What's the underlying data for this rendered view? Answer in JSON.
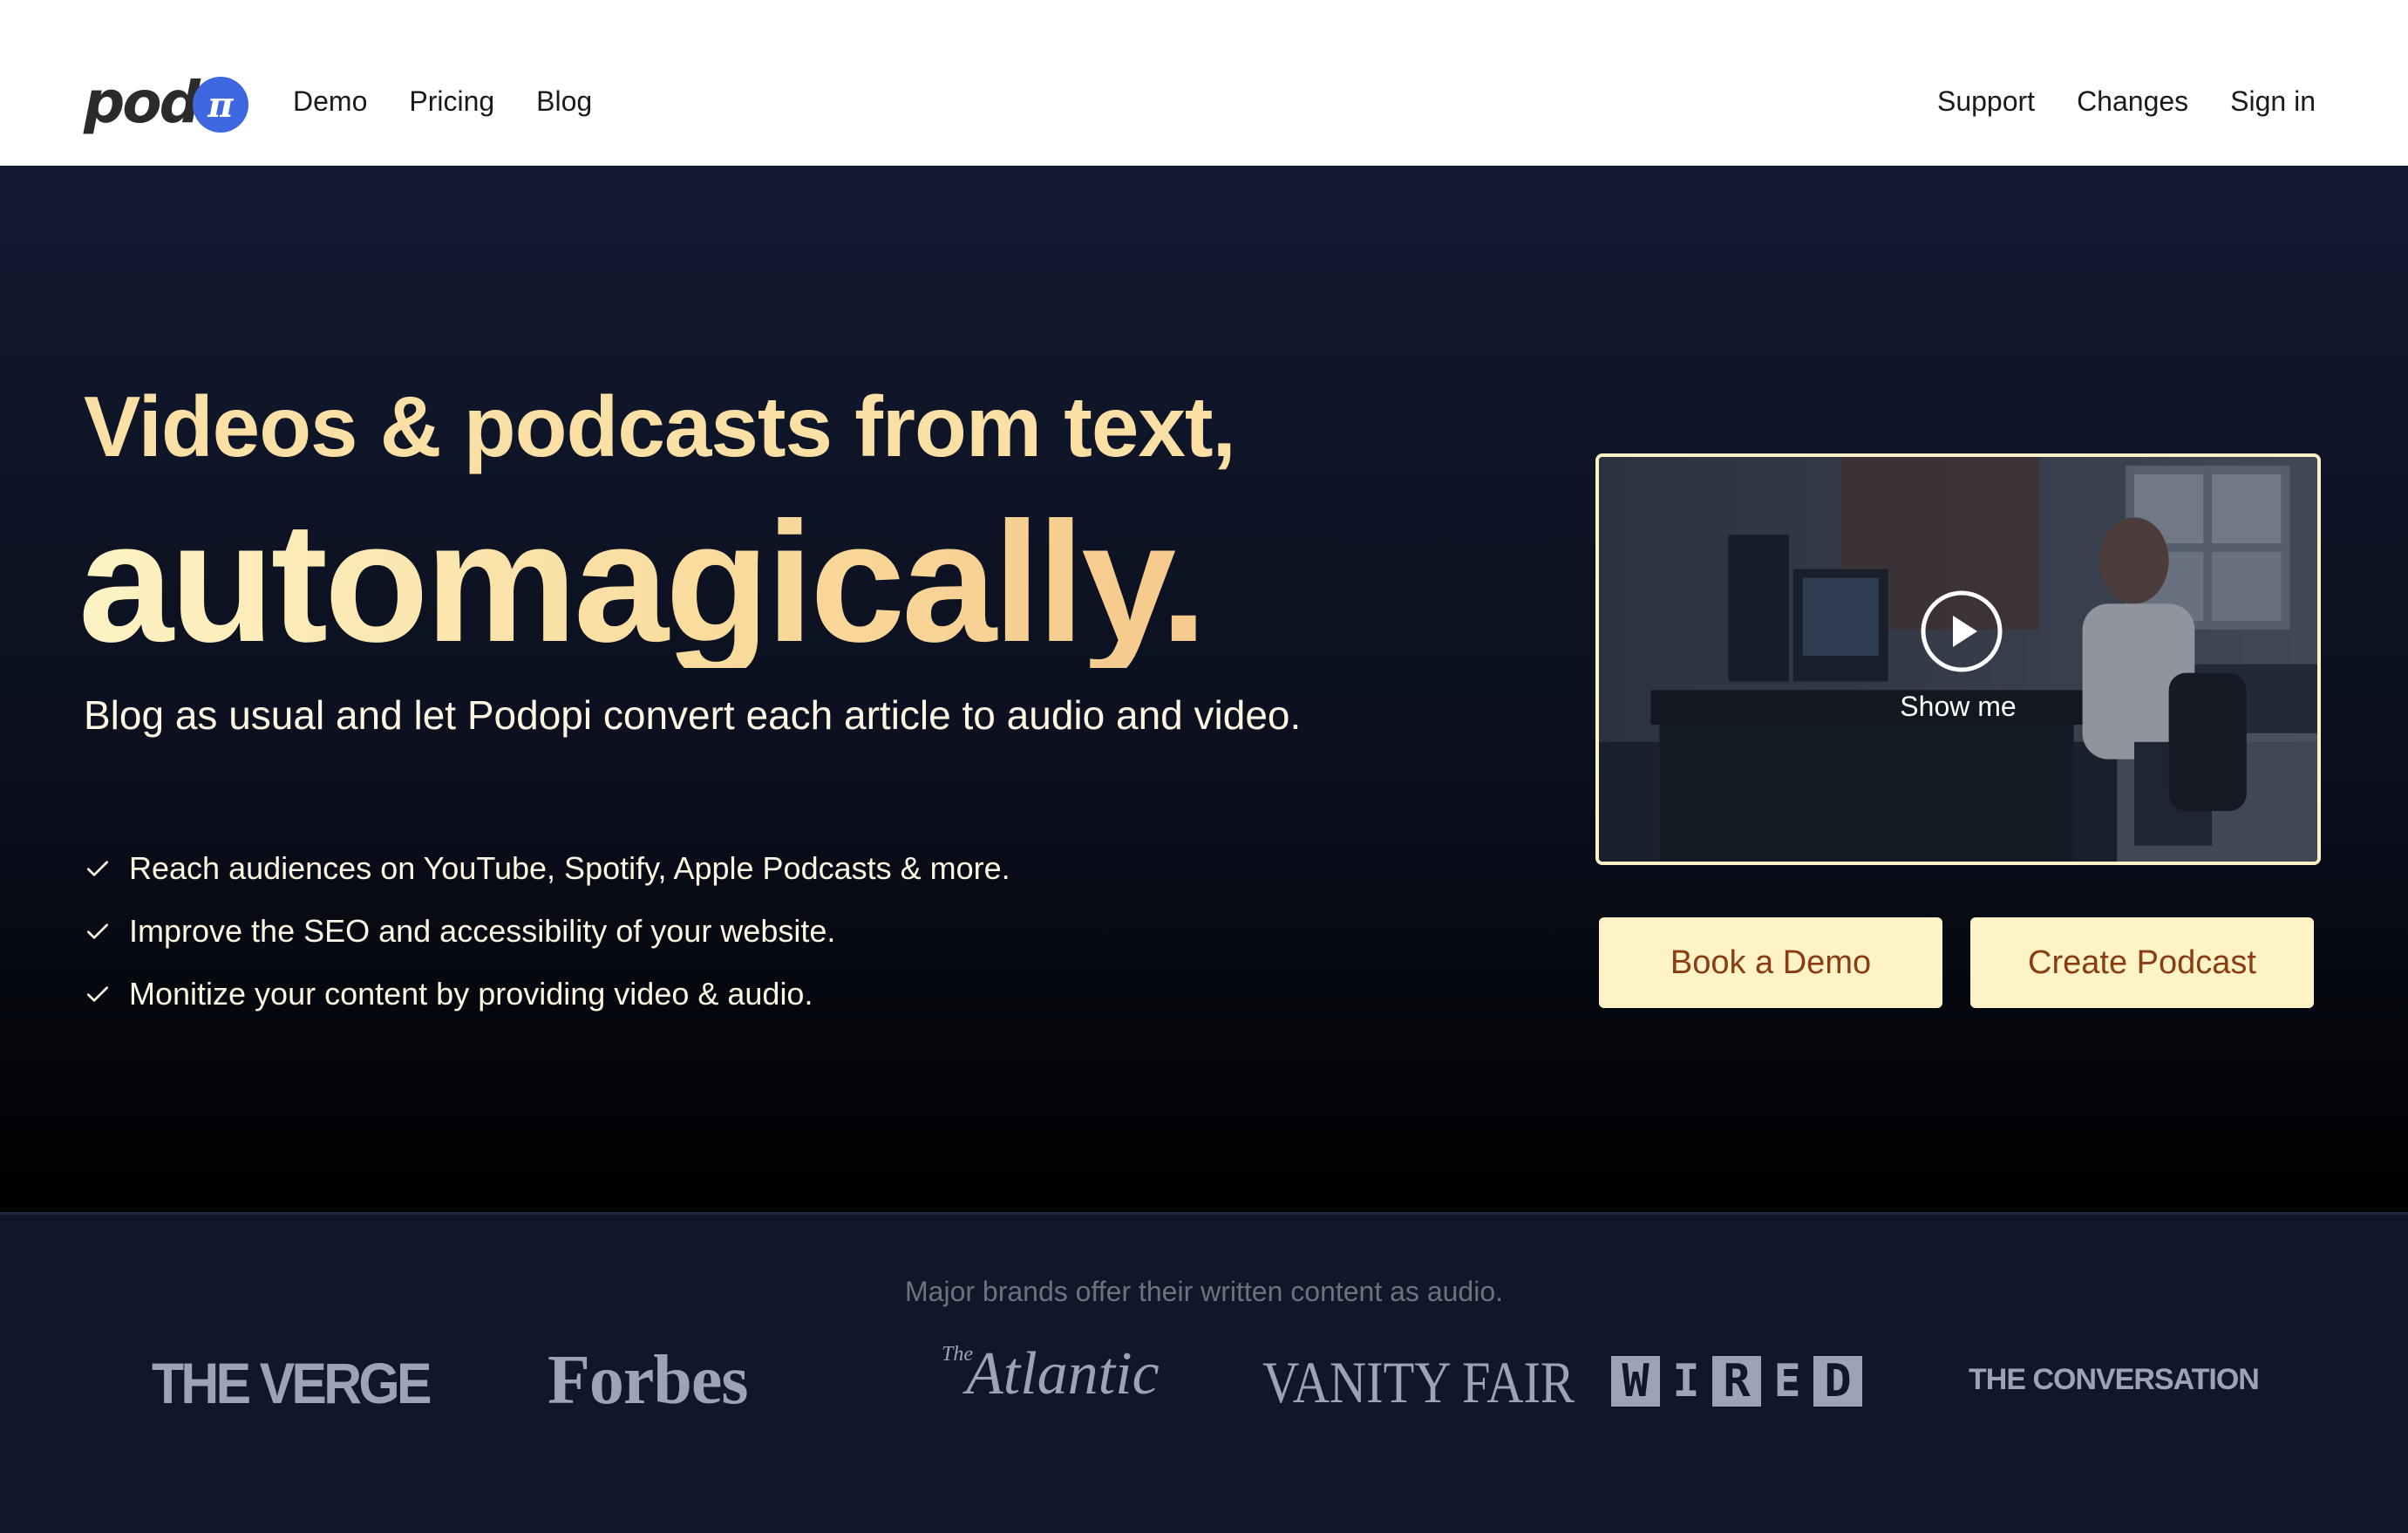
{
  "header": {
    "logo_text": "pod",
    "logo_badge": "π",
    "nav_left": [
      "Demo",
      "Pricing",
      "Blog"
    ],
    "nav_right": [
      "Support",
      "Changes",
      "Sign in"
    ]
  },
  "hero": {
    "title_line1": "Videos & podcasts from text,",
    "title_line2": "automagically.",
    "subtitle": "Blog as usual and let Podopi convert each article to audio and video.",
    "features": [
      "Reach audiences on YouTube, Spotify, Apple Podcasts & more.",
      "Improve the SEO and accessibility of your website.",
      "Monitize your content by providing video & audio."
    ],
    "video_label": "Show me",
    "buttons": {
      "demo": "Book a Demo",
      "create": "Create Podcast"
    }
  },
  "brands": {
    "caption": "Major brands offer their written content as audio.",
    "logos": {
      "verge": "THE VERGE",
      "forbes": "Forbes",
      "atlantic_prefix": "The",
      "atlantic": "Atlantic",
      "vanity": "VANITY FAIR",
      "wired": [
        "W",
        "I",
        "R",
        "E",
        "D"
      ],
      "conversation": "THE CONVERSATION"
    }
  },
  "colors": {
    "accent_gold": "#fbe0a6",
    "button_bg": "#fef3c7",
    "button_text": "#8a3c12",
    "logo_blue": "#3d68e0"
  }
}
